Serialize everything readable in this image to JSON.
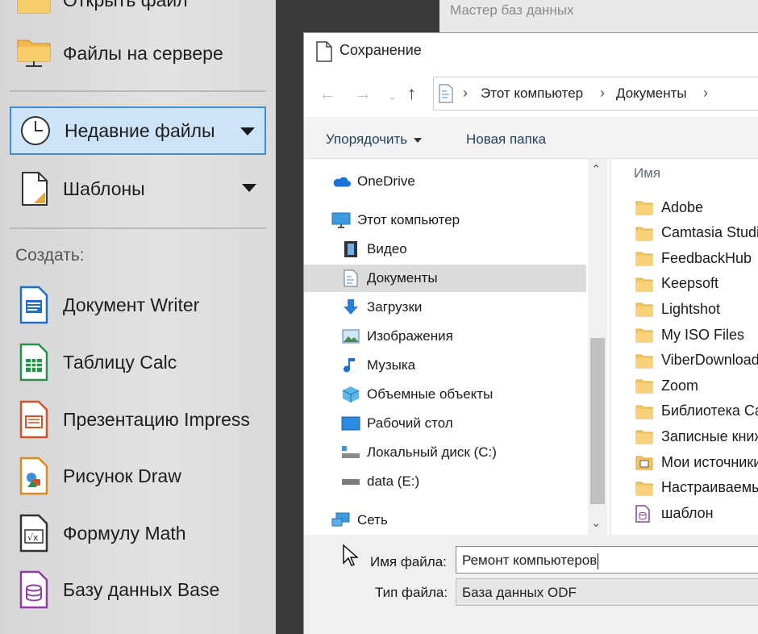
{
  "start_center": {
    "items_top": [
      {
        "label": "Открыть файл",
        "icon": "folder-icon"
      },
      {
        "label": "Файлы на сервере",
        "icon": "server-folder-icon"
      },
      {
        "label": "Недавние файлы",
        "icon": "clock-icon",
        "selected": true
      },
      {
        "label": "Шаблоны",
        "icon": "template-icon"
      }
    ],
    "create_heading": "Создать:",
    "create_items": [
      {
        "label": "Документ Writer",
        "icon": "writer-icon",
        "color": "#1f6fc5"
      },
      {
        "label": "Таблицу Calc",
        "icon": "calc-icon",
        "color": "#23944a"
      },
      {
        "label": "Презентацию Impress",
        "icon": "impress-icon",
        "color": "#d2522a"
      },
      {
        "label": "Рисунок Draw",
        "icon": "draw-icon",
        "color": "#d98b21"
      },
      {
        "label": "Формулу Math",
        "icon": "math-icon",
        "color": "#333333"
      },
      {
        "label": "Базу данных Base",
        "icon": "base-icon",
        "color": "#8c3fa0"
      }
    ]
  },
  "background_window_title": "Мастер баз данных",
  "dialog": {
    "title": "Сохранение",
    "breadcrumb": [
      "Этот компьютер",
      "Документы"
    ],
    "toolbar": {
      "organize": "Упорядочить",
      "new_folder": "Новая папка"
    },
    "nav": [
      {
        "label": "OneDrive",
        "icon": "onedrive-icon",
        "level": 0
      },
      {
        "label": "Этот компьютер",
        "icon": "computer-icon",
        "level": 0
      },
      {
        "label": "Видео",
        "icon": "video-icon",
        "level": 1
      },
      {
        "label": "Документы",
        "icon": "documents-icon",
        "level": 1,
        "active": true
      },
      {
        "label": "Загрузки",
        "icon": "downloads-icon",
        "level": 1
      },
      {
        "label": "Изображения",
        "icon": "pictures-icon",
        "level": 1
      },
      {
        "label": "Музыка",
        "icon": "music-icon",
        "level": 1
      },
      {
        "label": "Объемные объекты",
        "icon": "3d-objects-icon",
        "level": 1
      },
      {
        "label": "Рабочий стол",
        "icon": "desktop-icon",
        "level": 1
      },
      {
        "label": "Локальный диск (C:)",
        "icon": "drive-c-icon",
        "level": 1
      },
      {
        "label": "data (E:)",
        "icon": "drive-e-icon",
        "level": 1
      },
      {
        "label": "Сеть",
        "icon": "network-icon",
        "level": 0
      }
    ],
    "column_name": "Имя",
    "files": [
      {
        "label": "Adobe",
        "type": "folder"
      },
      {
        "label": "Camtasia Studio",
        "type": "folder"
      },
      {
        "label": "FeedbackHub",
        "type": "folder"
      },
      {
        "label": "Keepsoft",
        "type": "folder"
      },
      {
        "label": "Lightshot",
        "type": "folder"
      },
      {
        "label": "My ISO Files",
        "type": "folder"
      },
      {
        "label": "ViberDownloads",
        "type": "folder"
      },
      {
        "label": "Zoom",
        "type": "folder"
      },
      {
        "label": "Библиотека Ca",
        "type": "folder"
      },
      {
        "label": "Записные книж",
        "type": "folder"
      },
      {
        "label": "Мои источники",
        "type": "special-folder"
      },
      {
        "label": "Настраиваемы",
        "type": "folder"
      },
      {
        "label": "шаблон",
        "type": "odb-file"
      }
    ],
    "filename_label": "Имя файла:",
    "filename_value": "Ремонт компьютеров",
    "filetype_label": "Тип файла:",
    "filetype_value": "База данных ODF"
  }
}
